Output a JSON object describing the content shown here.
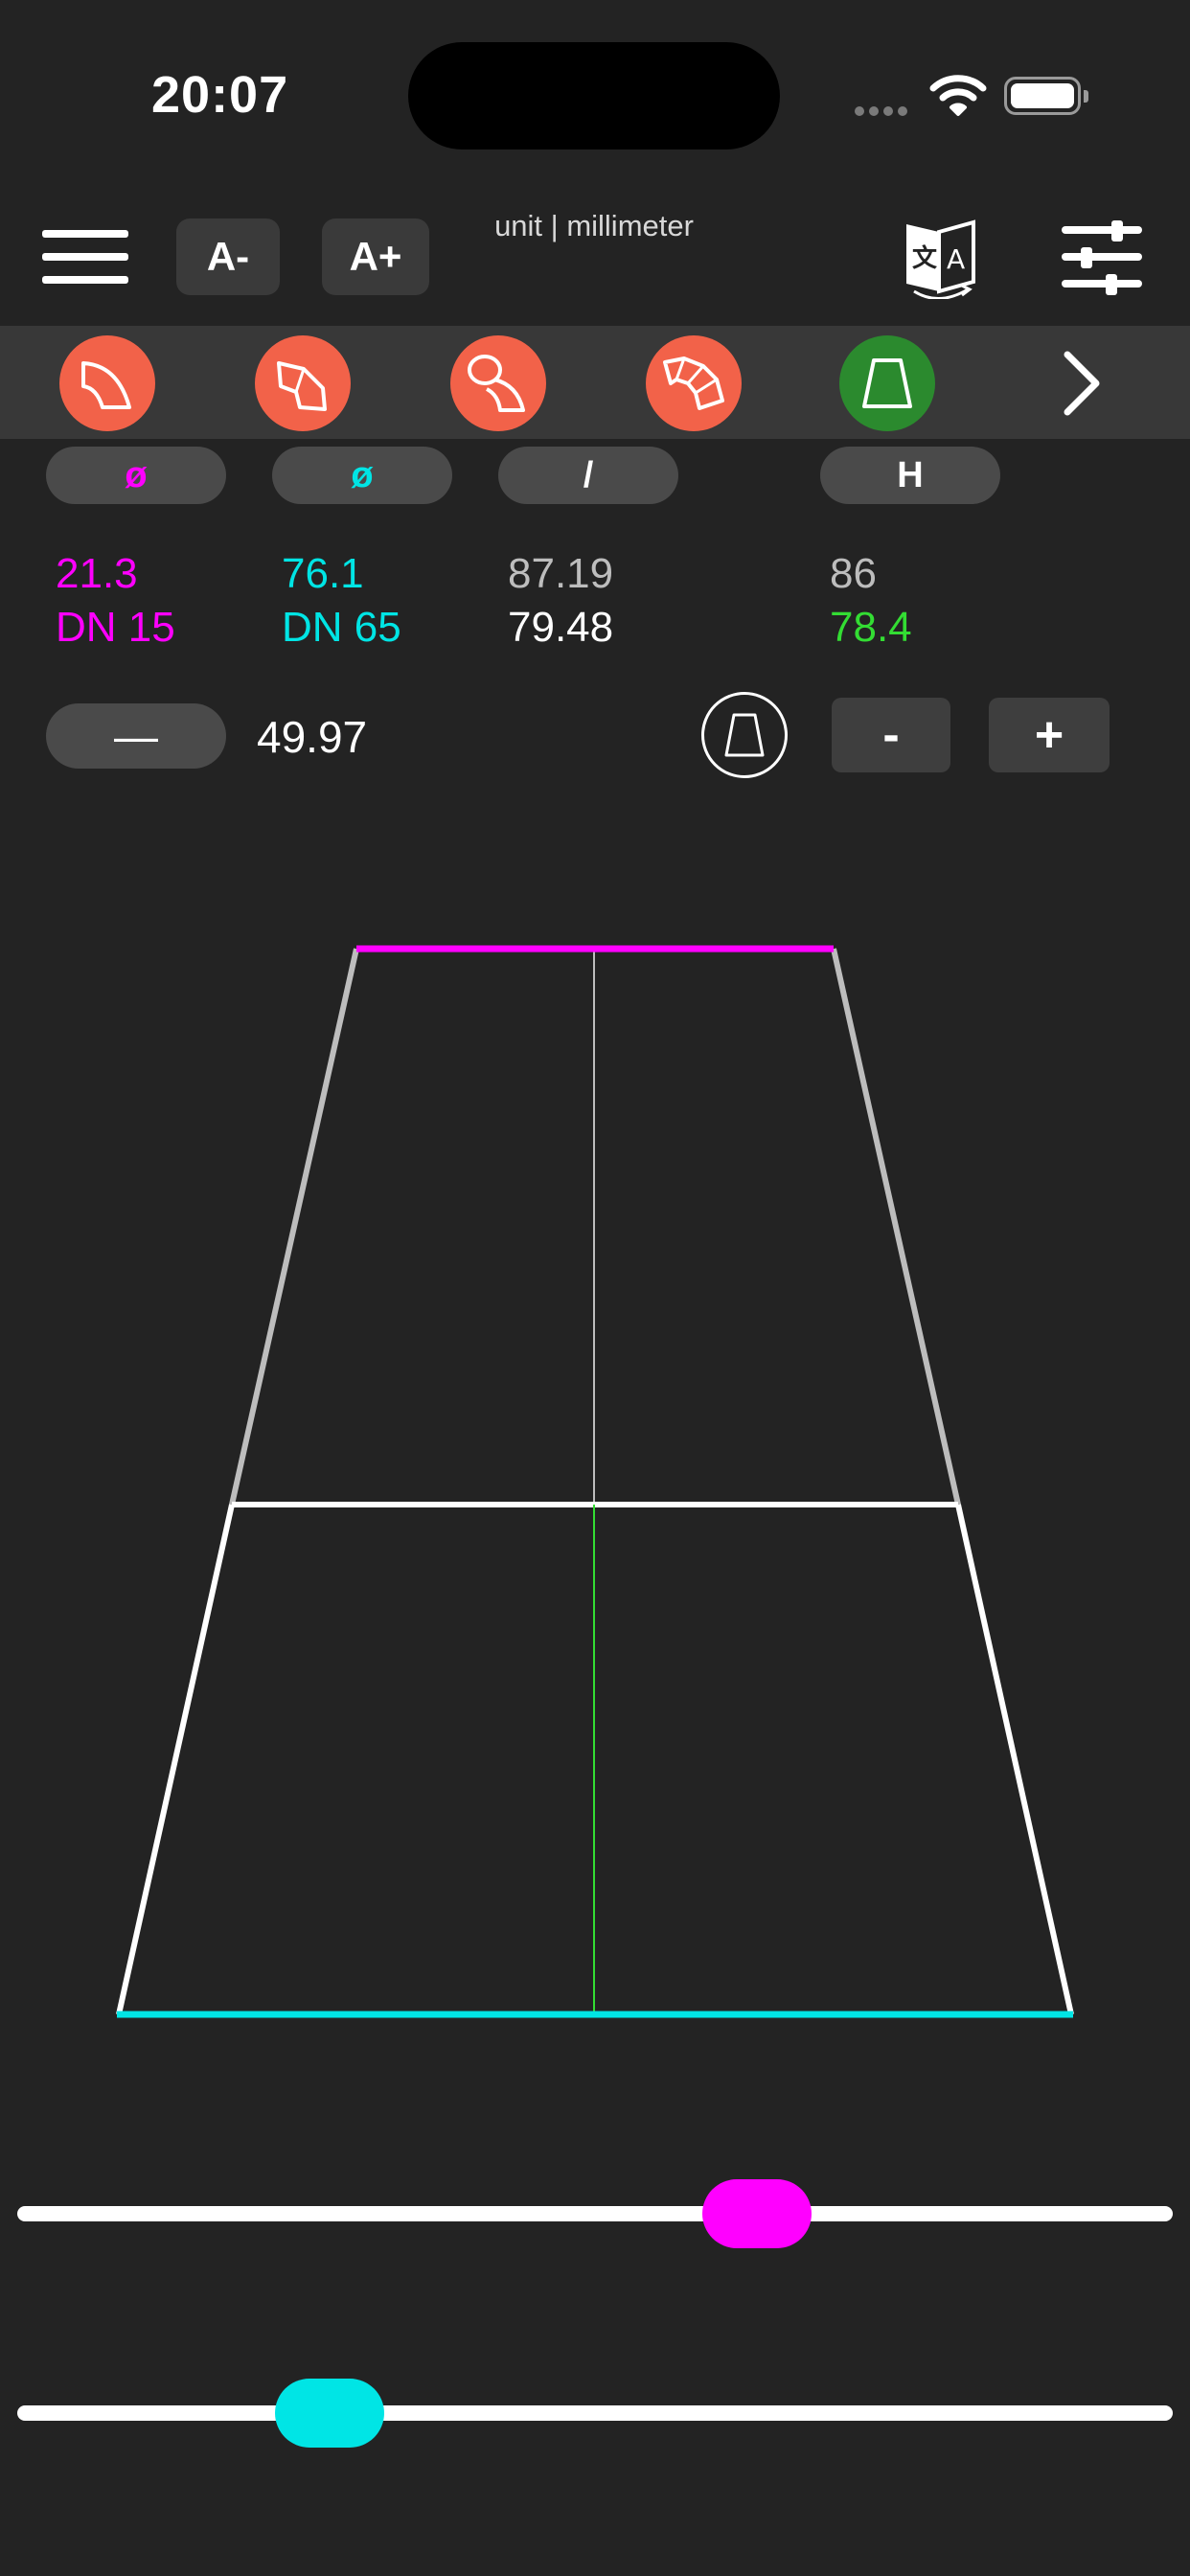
{
  "status_bar": {
    "time": "20:07"
  },
  "toolbar": {
    "font_smaller_label": "A-",
    "font_larger_label": "A+",
    "unit_text": "unit | millimeter"
  },
  "shape_buttons": [
    {
      "name": "pipe-bend-icon",
      "color": "#f26249"
    },
    {
      "name": "segmented-bend-icon",
      "color": "#f26249"
    },
    {
      "name": "branch-pipe-icon",
      "color": "#f26249"
    },
    {
      "name": "multi-segment-bend-icon",
      "color": "#f26249"
    },
    {
      "name": "cone-reducer-icon",
      "color": "#2b8a2e",
      "selected": true
    }
  ],
  "pills": {
    "diameter_small": "ø",
    "diameter_large": "ø",
    "slant": "/",
    "height": "H"
  },
  "values": {
    "small_diameter": "21.3",
    "small_dn": "DN 15",
    "large_diameter": "76.1",
    "large_dn": "DN 65",
    "slant_top": "87.19",
    "slant_bottom": "79.48",
    "height_top": "86",
    "height_bottom": "78.4"
  },
  "controls": {
    "line_label": "—",
    "length_value": "49.97",
    "minus_label": "-",
    "plus_label": "+"
  },
  "sliders": {
    "top_slider_fraction": 0.64,
    "bottom_slider_fraction": 0.27
  },
  "colors": {
    "small_diameter": "#ff00ff",
    "large_diameter": "#00e5e5",
    "height": "#33dd33",
    "accent_orange": "#f26249",
    "selected_green": "#2b8a2e",
    "background": "#232323"
  }
}
